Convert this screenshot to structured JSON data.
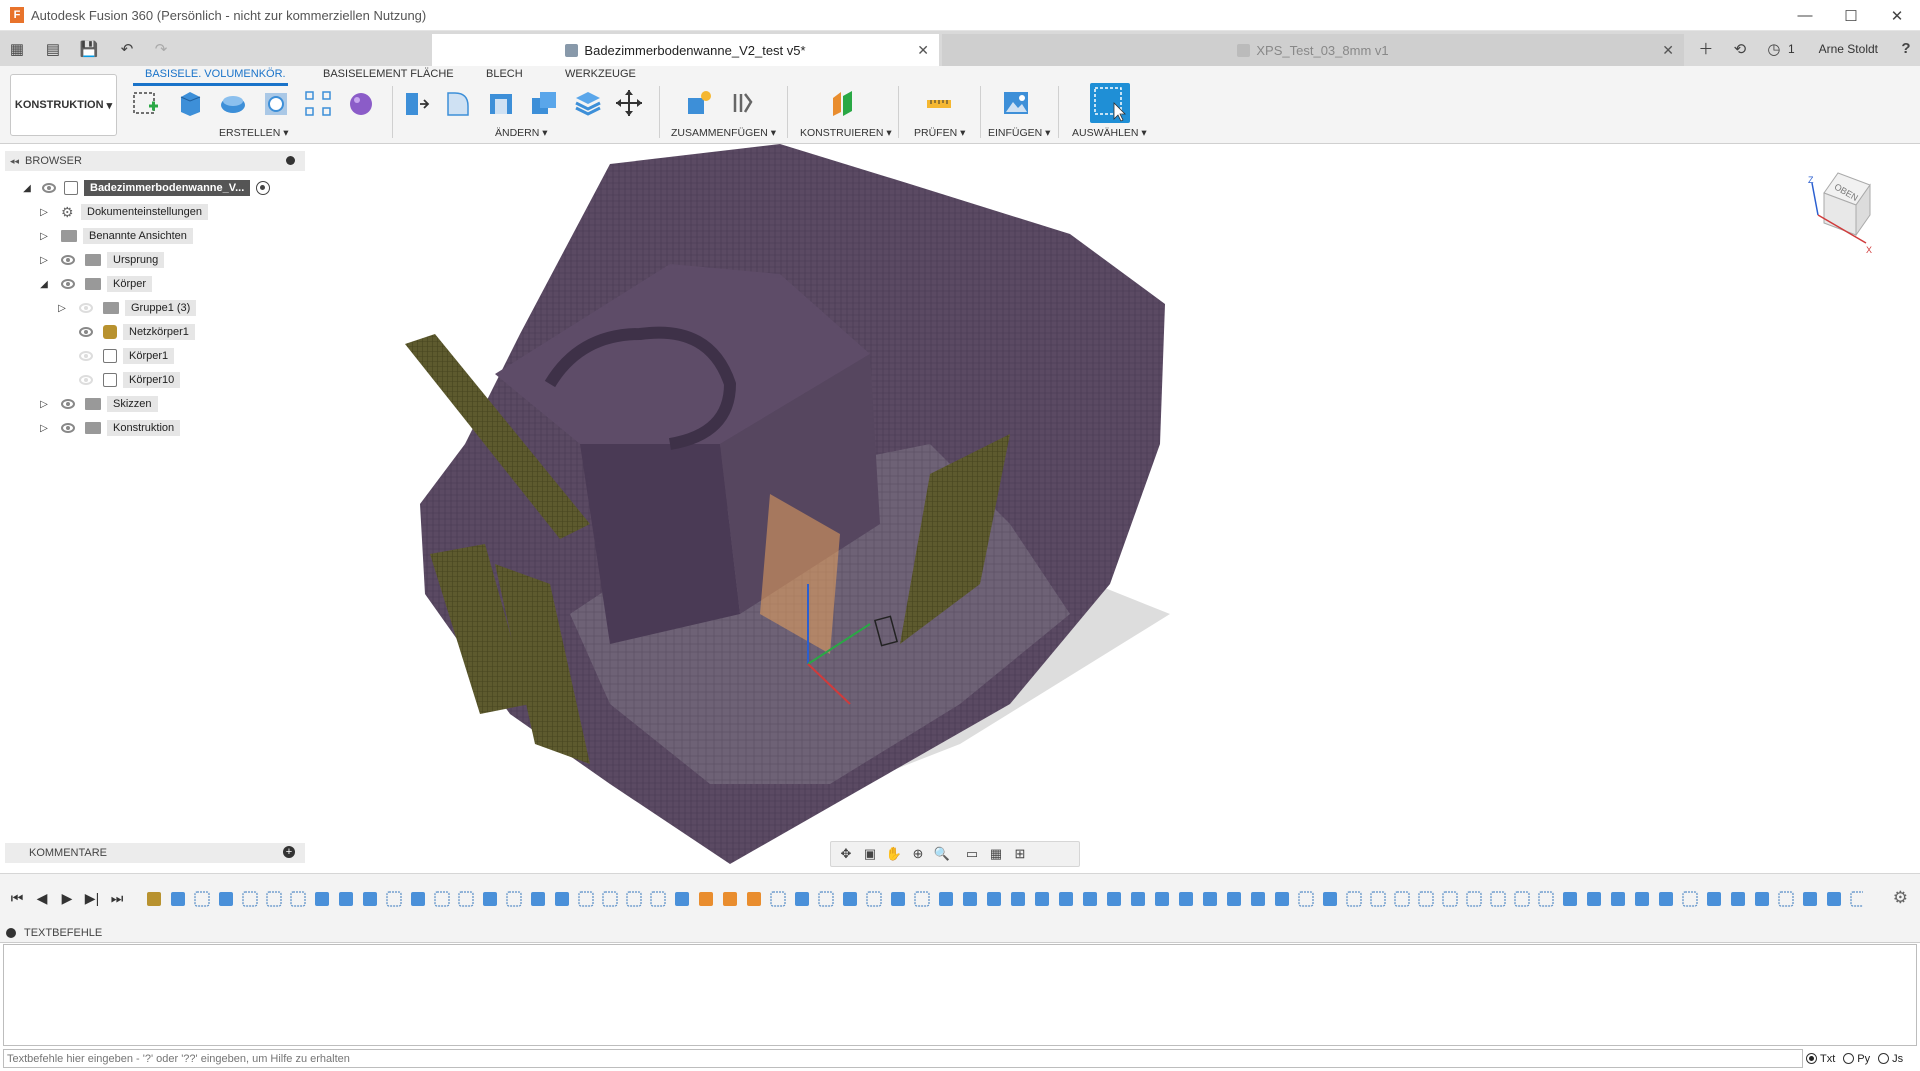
{
  "window": {
    "title": "Autodesk Fusion 360 (Persönlich - nicht zur kommerziellen Nutzung)",
    "logo_letter": "F",
    "controls": {
      "minimize": "—",
      "maximize": "☐",
      "close": "✕"
    }
  },
  "tabs": {
    "active": {
      "label": "Badezimmerbodenwanne_V2_test v5*",
      "close": "✕"
    },
    "inactive": {
      "label": "XPS_Test_03_8mm v1",
      "close": "✕"
    },
    "job_count": "1",
    "user": "Arne Stoldt",
    "help": "?"
  },
  "toolbar": {
    "workspace": "KONSTRUKTION",
    "ribbon_tabs": [
      "BASISELE. VOLUMENKÖR.",
      "BASISELEMENT FLÄCHE",
      "BLECH",
      "WERKZEUGE"
    ],
    "groups": [
      "ERSTELLEN",
      "ÄNDERN",
      "ZUSAMMENFÜGEN",
      "KONSTRUIEREN",
      "PRÜFEN",
      "EINFÜGEN",
      "AUSWÄHLEN"
    ]
  },
  "browser": {
    "title": "BROWSER",
    "root": "Badezimmerbodenwanne_V...",
    "items": [
      {
        "label": "Dokumenteinstellungen"
      },
      {
        "label": "Benannte Ansichten"
      },
      {
        "label": "Ursprung"
      },
      {
        "label": "Körper"
      },
      {
        "label": "Gruppe1 (3)"
      },
      {
        "label": "Netzkörper1"
      },
      {
        "label": "Körper1"
      },
      {
        "label": "Körper10"
      },
      {
        "label": "Skizzen"
      },
      {
        "label": "Konstruktion"
      }
    ]
  },
  "viewcube": {
    "face_label": "OBEN",
    "axis_x": "X",
    "axis_z": "Z"
  },
  "comments": {
    "title": "KOMMENTARE"
  },
  "textcommands": {
    "title": "TEXTBEFEHLE",
    "placeholder": "Textbefehle hier eingeben - '?' oder '??' eingeben, um Hilfe zu erhalten",
    "modes": [
      "Txt",
      "Py",
      "Js"
    ],
    "selected_mode": "Txt"
  },
  "colors": {
    "accent": "#1a73c9",
    "mesh": "#5b4a63",
    "wall_panel": "#5d5a2e",
    "timeline_body": "#4a90d9",
    "timeline_sketch": "#e98d2e"
  }
}
